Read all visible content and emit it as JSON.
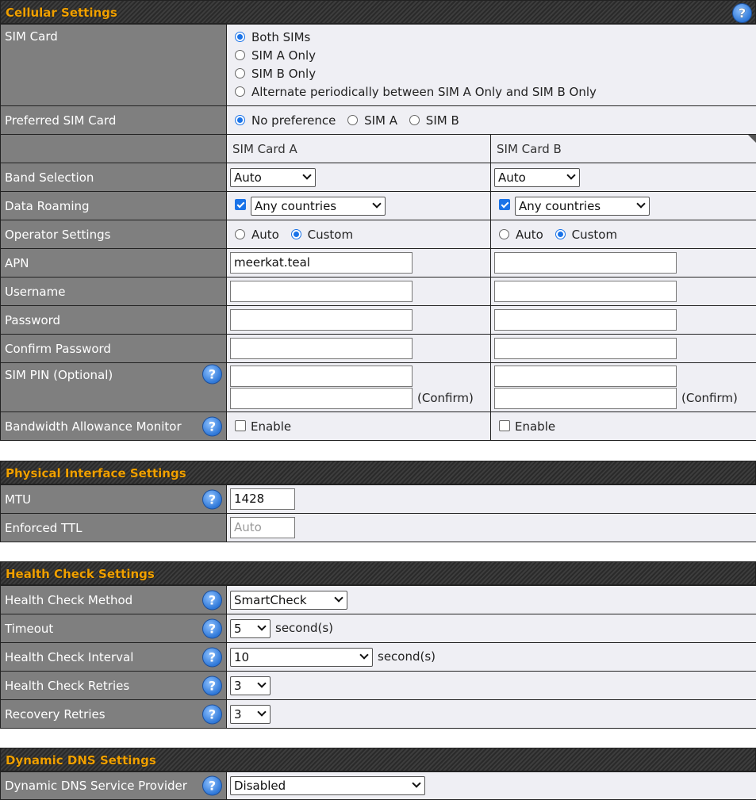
{
  "cellular": {
    "title": "Cellular Settings",
    "sim_card": {
      "label": "SIM Card",
      "options": [
        "Both SIMs",
        "SIM A Only",
        "SIM B Only",
        "Alternate periodically between SIM A Only and SIM B Only"
      ],
      "selected": "Both SIMs"
    },
    "preferred": {
      "label": "Preferred SIM Card",
      "options": [
        "No preference",
        "SIM A",
        "SIM B"
      ],
      "selected": "No preference"
    },
    "col_a": "SIM Card A",
    "col_b": "SIM Card B",
    "band": {
      "label": "Band Selection",
      "a": "Auto",
      "b": "Auto"
    },
    "roaming": {
      "label": "Data Roaming",
      "a": "Any countries",
      "b": "Any countries",
      "a_checked": true,
      "b_checked": true
    },
    "operator": {
      "label": "Operator Settings",
      "opt_auto": "Auto",
      "opt_custom": "Custom",
      "a": "Custom",
      "b": "Custom"
    },
    "apn": {
      "label": "APN",
      "a": "meerkat.teal",
      "b": ""
    },
    "username": {
      "label": "Username",
      "a": "",
      "b": ""
    },
    "password": {
      "label": "Password",
      "a": "",
      "b": ""
    },
    "confirm_password": {
      "label": "Confirm Password",
      "a": "",
      "b": ""
    },
    "sim_pin": {
      "label": "SIM PIN (Optional)",
      "confirm": "(Confirm)"
    },
    "bandwidth": {
      "label": "Bandwidth Allowance Monitor",
      "enable": "Enable",
      "a_checked": false,
      "b_checked": false
    }
  },
  "physical": {
    "title": "Physical Interface Settings",
    "mtu": {
      "label": "MTU",
      "value": "1428"
    },
    "ttl": {
      "label": "Enforced TTL",
      "placeholder": "Auto"
    }
  },
  "health": {
    "title": "Health Check Settings",
    "method": {
      "label": "Health Check Method",
      "value": "SmartCheck"
    },
    "timeout": {
      "label": "Timeout",
      "value": "5",
      "unit": "second(s)"
    },
    "interval": {
      "label": "Health Check Interval",
      "value": "10",
      "unit": "second(s)"
    },
    "retries": {
      "label": "Health Check Retries",
      "value": "3"
    },
    "recovery": {
      "label": "Recovery Retries",
      "value": "3"
    }
  },
  "ddns": {
    "title": "Dynamic DNS Settings",
    "provider": {
      "label": "Dynamic DNS Service Provider",
      "value": "Disabled"
    }
  },
  "help_glyph": "?",
  "colors": {
    "header_text": "#f0a000",
    "label_bg": "#7f7f7f",
    "value_bg": "#efeff4",
    "accent": "#1a73e8"
  }
}
